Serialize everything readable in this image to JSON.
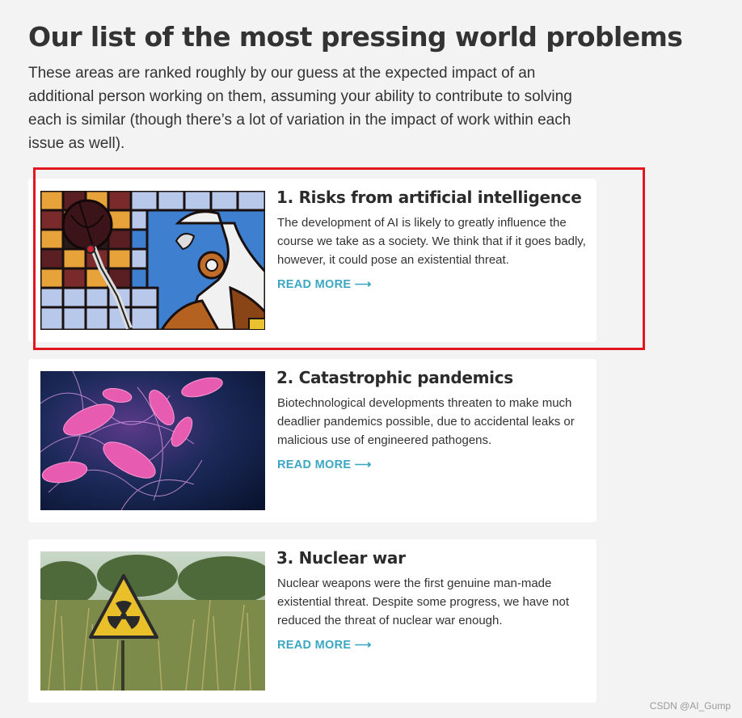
{
  "page": {
    "heading": "Our list of the most pressing world problems",
    "intro": "These areas are ranked roughly by our guess at the expected impact of an additional person working on them, assuming your ability to contribute to solving each is similar (though there’s a lot of variation in the impact of work within each issue as well)."
  },
  "problems": [
    {
      "title": "1. Risks from artificial intelligence",
      "description": "The development of AI is likely to greatly influence the course we take as a society. We think that if it goes badly, however, it could pose an existential threat.",
      "link": "READ MORE ⟶",
      "image": "stained-glass-robot"
    },
    {
      "title": "2. Catastrophic pandemics",
      "description": "Biotechnological developments threaten to make much deadlier pandemics possible, due to accidental leaks or malicious use of engineered pathogens.",
      "link": "READ MORE ⟶",
      "image": "bacteria-microscopy"
    },
    {
      "title": "3. Nuclear war",
      "description": "Nuclear weapons were the first genuine man-made existential threat. Despite some progress, we have not reduced the threat of nuclear war enough.",
      "link": "READ MORE ⟶",
      "image": "radiation-warning-sign"
    }
  ],
  "watermark": "CSDN @AI_Gump",
  "colors": {
    "background": "#f3f3f3",
    "card": "#ffffff",
    "link": "#3aa6c2",
    "highlight": "#e0171f"
  }
}
